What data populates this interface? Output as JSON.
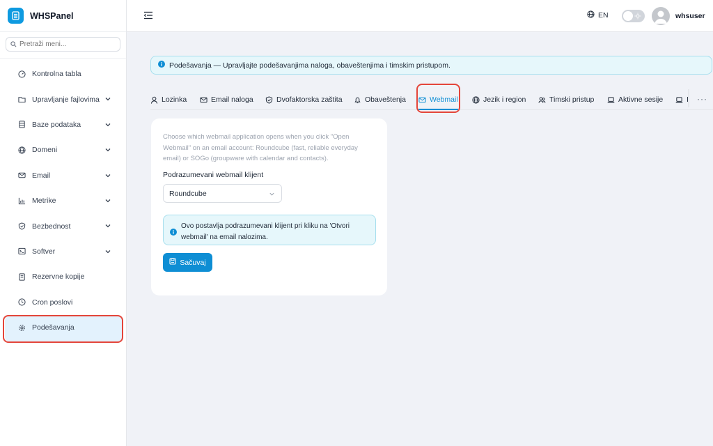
{
  "app": {
    "name": "WHSPanel"
  },
  "sidebar": {
    "search_placeholder": "Pretraži meni...",
    "items": [
      {
        "label": "Kontrolna tabla",
        "icon": "dashboard-icon",
        "has_submenu": false
      },
      {
        "label": "Upravljanje fajlovima",
        "icon": "folder-icon",
        "has_submenu": true
      },
      {
        "label": "Baze podataka",
        "icon": "database-icon",
        "has_submenu": true
      },
      {
        "label": "Domeni",
        "icon": "globe-icon",
        "has_submenu": true
      },
      {
        "label": "Email",
        "icon": "mail-icon",
        "has_submenu": true
      },
      {
        "label": "Metrike",
        "icon": "chart-icon",
        "has_submenu": true
      },
      {
        "label": "Bezbednost",
        "icon": "shield-icon",
        "has_submenu": true
      },
      {
        "label": "Softver",
        "icon": "terminal-icon",
        "has_submenu": true
      },
      {
        "label": "Rezervne kopije",
        "icon": "backup-icon",
        "has_submenu": false
      },
      {
        "label": "Cron poslovi",
        "icon": "clock-icon",
        "has_submenu": false
      },
      {
        "label": "Podešavanja",
        "icon": "gear-icon",
        "has_submenu": false,
        "active": true
      }
    ]
  },
  "topbar": {
    "language": "EN",
    "username": "whsuser"
  },
  "banner": {
    "text": "Podešavanja — Upravljajte podešavanjima naloga, obaveštenjima i timskim pristupom."
  },
  "tabs": [
    {
      "label": "Lozinka",
      "icon": "user-icon"
    },
    {
      "label": "Email naloga",
      "icon": "mail-icon"
    },
    {
      "label": "Dvofaktorska zaštita",
      "icon": "shield-check-icon"
    },
    {
      "label": "Obaveštenja",
      "icon": "bell-icon"
    },
    {
      "label": "Webmail",
      "icon": "mail-icon",
      "active": true
    },
    {
      "label": "Jezik i region",
      "icon": "globe-icon"
    },
    {
      "label": "Timski pristup",
      "icon": "users-icon"
    },
    {
      "label": "Aktivne sesije",
      "icon": "laptop-icon"
    },
    {
      "label": "Is",
      "icon": "laptop-icon"
    }
  ],
  "tabs_more": "···",
  "webmail": {
    "description": "Choose which webmail application opens when you click \"Open Webmail\" on an email account: Roundcube (fast, reliable everyday email) or SOGo (groupware with calendar and contacts).",
    "client_label": "Podrazumevani webmail klijent",
    "client_value": "Roundcube",
    "note": "Ovo postavlja podrazumevani klijent pri kliku na 'Otvori webmail' na email nalozima.",
    "save_label": "Sačuvaj"
  },
  "colors": {
    "accent": "#0e8ed4",
    "highlight": "#e4453a",
    "info_bg": "#e6f7fb"
  }
}
